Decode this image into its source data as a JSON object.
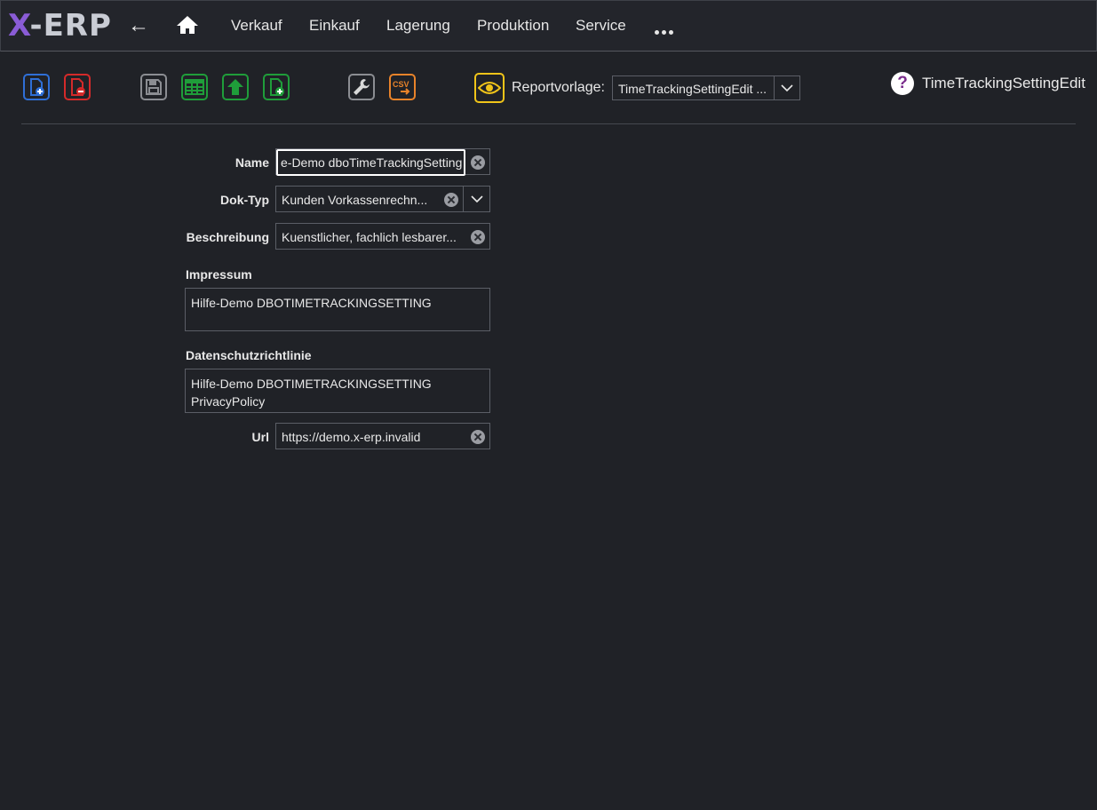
{
  "app": {
    "logo_x": "X",
    "logo_rest": "-ERP"
  },
  "nav": {
    "back": "←",
    "items": [
      "Verkauf",
      "Einkauf",
      "Lagerung",
      "Produktion",
      "Service"
    ]
  },
  "toolbar": {
    "report_label": "Reportvorlage:",
    "report_value": "TimeTrackingSettingEdit ...",
    "csv": "CSV",
    "help": "?",
    "page_title": "TimeTrackingSettingEdit"
  },
  "form": {
    "name_label": "Name",
    "name_value": "e-Demo dboTimeTrackingSetting",
    "doktyp_label": "Dok-Typ",
    "doktyp_value": "Kunden Vorkassenrechn...",
    "beschreibung_label": "Beschreibung",
    "beschreibung_value": "Kuenstlicher, fachlich lesbarer...",
    "impressum_label": "Impressum",
    "impressum_value": "Hilfe-Demo DBOTIMETRACKINGSETTING",
    "datenschutz_label": "Datenschutzrichtlinie",
    "datenschutz_value": "Hilfe-Demo DBOTIMETRACKINGSETTING\nPrivacyPolicy",
    "url_label": "Url",
    "url_value": "https://demo.x-erp.invalid"
  },
  "colors": {
    "background": "#202227",
    "accent_blue": "#2f6fd6",
    "danger_red": "#d42a2a",
    "ok_green": "#1f9d3a",
    "gray": "#8b8d92",
    "orange": "#e8832a",
    "yellow": "#f0c419"
  },
  "icons": [
    "home-icon",
    "new-document-icon",
    "delete-document-icon",
    "save-icon",
    "table-icon",
    "upload-icon",
    "add-document-icon",
    "wrench-icon",
    "csv-export-icon",
    "eye-icon",
    "help-icon",
    "chevron-down-icon",
    "clear-icon"
  ]
}
